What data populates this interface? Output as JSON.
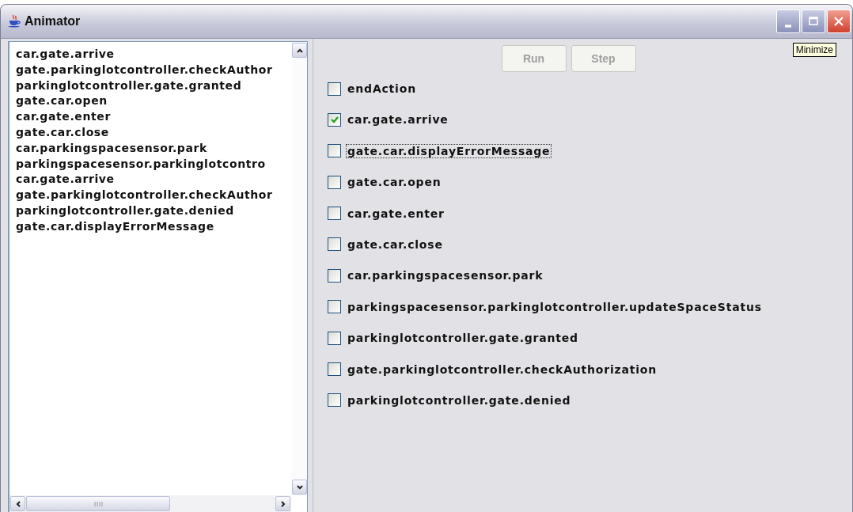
{
  "window": {
    "title": "Animator",
    "controls": [
      {
        "kind": "minimize"
      },
      {
        "kind": "maximize"
      },
      {
        "kind": "close"
      }
    ]
  },
  "tooltip": {
    "text": "Minimize"
  },
  "message_list": {
    "items": [
      "car.gate.arrive",
      "gate.parkinglotcontroller.checkAuthor",
      "parkinglotcontroller.gate.granted",
      "gate.car.open",
      "car.gate.enter",
      "gate.car.close",
      "car.parkingspacesensor.park",
      "parkingspacesensor.parkinglotcontro",
      "car.gate.arrive",
      "gate.parkinglotcontroller.checkAuthor",
      "parkinglotcontroller.gate.denied",
      "gate.car.displayErrorMessage"
    ]
  },
  "buttons": [
    {
      "label": "Run",
      "disabled": true
    },
    {
      "label": "Step",
      "disabled": true
    }
  ],
  "actions": [
    {
      "label": "endAction",
      "checked": false,
      "focused": false
    },
    {
      "label": "car.gate.arrive",
      "checked": true,
      "focused": false
    },
    {
      "label": "gate.car.displayErrorMessage",
      "checked": false,
      "focused": true
    },
    {
      "label": "gate.car.open",
      "checked": false,
      "focused": false
    },
    {
      "label": "car.gate.enter",
      "checked": false,
      "focused": false
    },
    {
      "label": "gate.car.close",
      "checked": false,
      "focused": false
    },
    {
      "label": "car.parkingspacesensor.park",
      "checked": false,
      "focused": false
    },
    {
      "label": "parkingspacesensor.parkinglotcontroller.updateSpaceStatus",
      "checked": false,
      "focused": false
    },
    {
      "label": "parkinglotcontroller.gate.granted",
      "checked": false,
      "focused": false
    },
    {
      "label": "gate.parkinglotcontroller.checkAuthorization",
      "checked": false,
      "focused": false
    },
    {
      "label": "parkinglotcontroller.gate.denied",
      "checked": false,
      "focused": false
    }
  ]
}
